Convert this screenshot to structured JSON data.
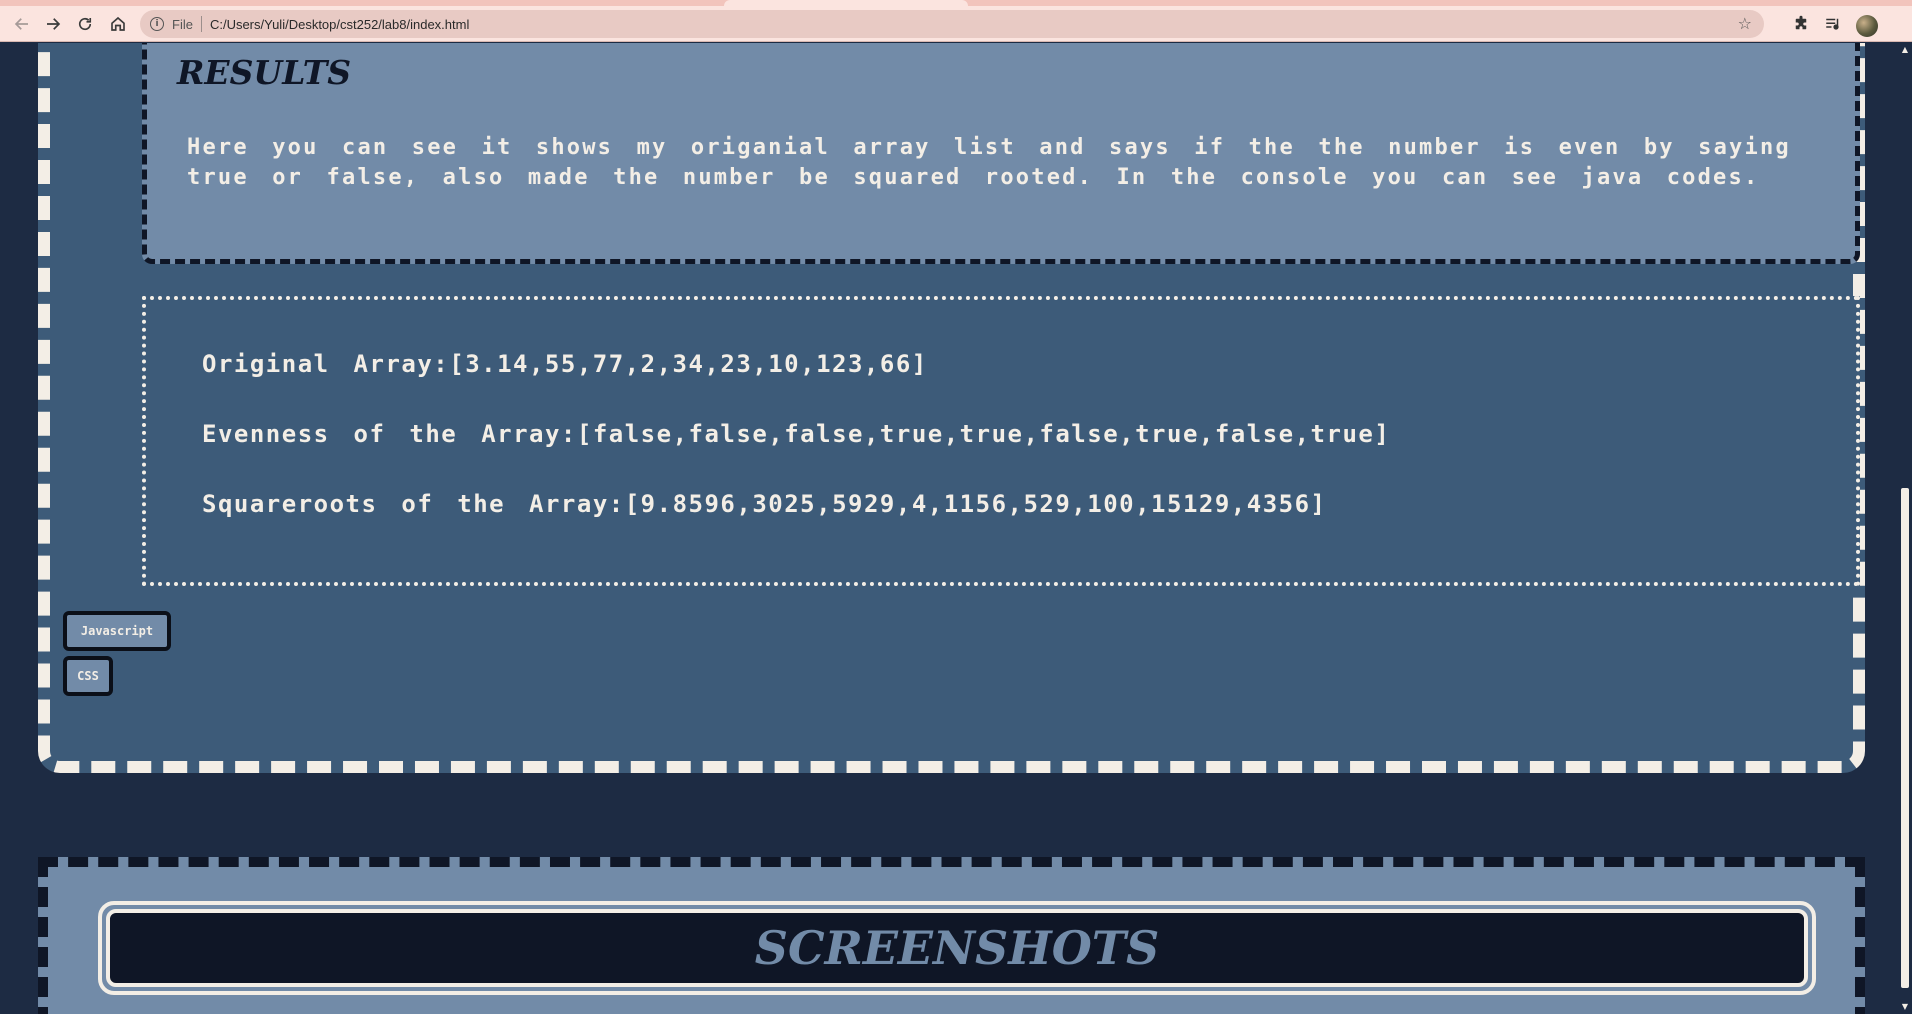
{
  "browser": {
    "scheme_label": "File",
    "url": "C:/Users/Yuli/Desktop/cst252/lab8/index.html",
    "icons": {
      "back": "back-arrow-icon",
      "forward": "forward-arrow-icon",
      "reload": "reload-icon",
      "home": "home-icon",
      "info": "info-icon",
      "bookmark": "star-icon",
      "extensions": "puzzle-icon",
      "media": "media-queue-icon",
      "profile": "avatar"
    },
    "info_glyph": "i",
    "star_glyph": "☆"
  },
  "results": {
    "title": "RESULTS",
    "description": "Here you can see it shows my origanial array list and says if the the number is even by saying true or false, also made the number be squared rooted. In the console you can see java codes."
  },
  "arrays": {
    "original": "Original Array:[3.14,55,77,2,34,23,10,123,66]",
    "evenness": "Evenness of the Array:[false,false,false,true,true,false,true,false,true]",
    "squareroots": "Squareroots of the Array:[9.8596,3025,5929,4,1156,529,100,15129,4356]"
  },
  "buttons": {
    "javascript": "Javascript",
    "css": "CSS"
  },
  "screenshots": {
    "title": "SCREENSHOTS"
  },
  "colors": {
    "page_bg": "#1d2b43",
    "section_bg": "#3d5b79",
    "panel_bg": "#728ba8",
    "cream": "#f3eee6",
    "dark": "#0f1626"
  }
}
